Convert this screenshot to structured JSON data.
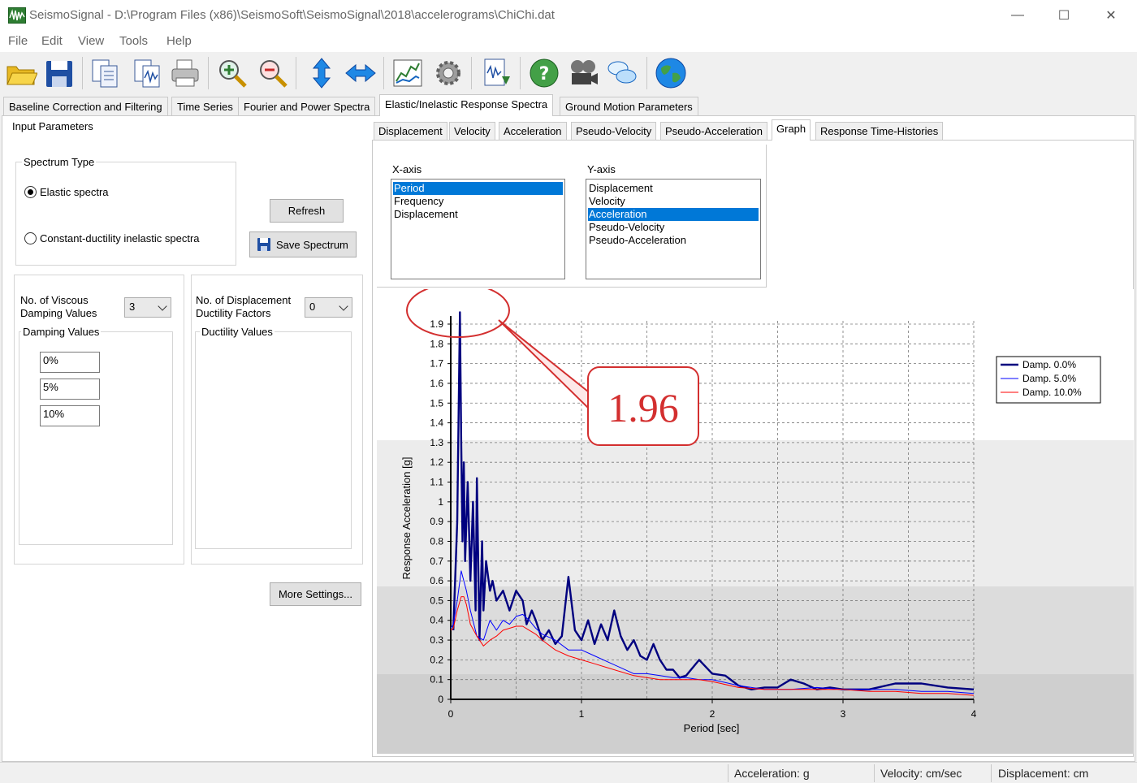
{
  "window": {
    "title": "SeismoSignal - D:\\Program Files (x86)\\SeismoSoft\\SeismoSignal\\2018\\accelerograms\\ChiChi.dat",
    "minimize": "—",
    "maximize": "☐",
    "close": "✕"
  },
  "menu": [
    "File",
    "Edit",
    "View",
    "Tools",
    "Help"
  ],
  "toolbar_icons": [
    "open-folder-icon",
    "save-icon",
    "copy-icon",
    "copy-graph-icon",
    "print-icon",
    "zoom-in-icon",
    "zoom-out-icon",
    "vertical-scale-icon",
    "horizontal-scale-icon",
    "chart-icon",
    "settings-gear-icon",
    "export-icon",
    "help-icon",
    "video-icon",
    "chat-icon",
    "globe-icon"
  ],
  "main_tabs": [
    "Baseline Correction and Filtering",
    "Time Series",
    "Fourier and Power Spectra",
    "Elastic/Inelastic Response Spectra",
    "Ground Motion Parameters"
  ],
  "left": {
    "input_parameters": "Input Parameters",
    "spectrum_type": "Spectrum Type",
    "elastic": "Elastic spectra",
    "inelastic": "Constant-ductility inelastic spectra",
    "refresh": "Refresh",
    "save_spectrum": "Save Spectrum",
    "no_viscous_1": "No. of Viscous",
    "no_viscous_2": "Damping Values",
    "no_viscous_value": "3",
    "damping_values": "Damping Values",
    "damping": [
      "0%",
      "5%",
      "10%"
    ],
    "no_disp_1": "No. of Displacement",
    "no_disp_2": "Ductility Factors",
    "no_disp_value": "0",
    "ductility_values": "Ductility Values",
    "more_settings": "More Settings..."
  },
  "sub_tabs": [
    "Displacement",
    "Velocity",
    "Acceleration",
    "Pseudo-Velocity",
    "Pseudo-Acceleration",
    "Graph",
    "Response Time-Histories"
  ],
  "xaxis_list": {
    "label": "X-axis",
    "items": [
      "Period",
      "Frequency",
      "Displacement"
    ],
    "selected": 0
  },
  "yaxis_list": {
    "label": "Y-axis",
    "items": [
      "Displacement",
      "Velocity",
      "Acceleration",
      "Pseudo-Velocity",
      "Pseudo-Acceleration"
    ],
    "selected": 2
  },
  "annotation": {
    "callout_text": "1.96",
    "color": "#d32f2f"
  },
  "chart_data": {
    "type": "line",
    "xlabel": "Period [sec]",
    "ylabel": "Response Acceleration [g]",
    "xlim": [
      0,
      4
    ],
    "ylim": [
      0,
      1.9
    ],
    "xticks": [
      "0",
      "1",
      "2",
      "3",
      "4"
    ],
    "yticks": [
      "0",
      "0.1",
      "0.2",
      "0.3",
      "0.4",
      "0.5",
      "0.6",
      "0.7",
      "0.8",
      "0.9",
      "1",
      "1.1",
      "1.2",
      "1.3",
      "1.4",
      "1.5",
      "1.6",
      "1.7",
      "1.8",
      "1.9"
    ],
    "grid": true,
    "legend_position": "top-right",
    "series": [
      {
        "name": "Damp. 0.0%",
        "color": "#00007f",
        "x": [
          0.02,
          0.05,
          0.07,
          0.08,
          0.09,
          0.1,
          0.11,
          0.13,
          0.15,
          0.17,
          0.19,
          0.2,
          0.22,
          0.24,
          0.25,
          0.27,
          0.3,
          0.32,
          0.35,
          0.4,
          0.45,
          0.5,
          0.55,
          0.58,
          0.62,
          0.65,
          0.7,
          0.75,
          0.8,
          0.85,
          0.9,
          0.95,
          1.0,
          1.05,
          1.1,
          1.15,
          1.2,
          1.25,
          1.3,
          1.35,
          1.4,
          1.45,
          1.5,
          1.55,
          1.6,
          1.65,
          1.7,
          1.75,
          1.8,
          1.9,
          2.0,
          2.1,
          2.2,
          2.3,
          2.4,
          2.5,
          2.6,
          2.7,
          2.8,
          2.9,
          3.0,
          3.2,
          3.4,
          3.6,
          3.8,
          4.0
        ],
        "y": [
          0.35,
          0.9,
          1.96,
          1.3,
          0.8,
          1.2,
          0.7,
          1.1,
          0.6,
          1.0,
          0.45,
          1.12,
          0.3,
          0.8,
          0.45,
          0.7,
          0.55,
          0.6,
          0.5,
          0.55,
          0.45,
          0.55,
          0.5,
          0.38,
          0.45,
          0.4,
          0.3,
          0.35,
          0.28,
          0.32,
          0.62,
          0.35,
          0.3,
          0.4,
          0.28,
          0.38,
          0.3,
          0.45,
          0.32,
          0.25,
          0.3,
          0.22,
          0.2,
          0.28,
          0.2,
          0.15,
          0.15,
          0.11,
          0.12,
          0.2,
          0.13,
          0.12,
          0.07,
          0.05,
          0.06,
          0.06,
          0.1,
          0.08,
          0.05,
          0.06,
          0.05,
          0.05,
          0.08,
          0.08,
          0.06,
          0.05
        ]
      },
      {
        "name": "Damp. 5.0%",
        "color": "#0000ff",
        "x": [
          0.0,
          0.02,
          0.05,
          0.08,
          0.1,
          0.12,
          0.15,
          0.2,
          0.25,
          0.3,
          0.35,
          0.4,
          0.45,
          0.5,
          0.55,
          0.6,
          0.65,
          0.7,
          0.8,
          0.9,
          1.0,
          1.1,
          1.2,
          1.3,
          1.4,
          1.5,
          1.6,
          1.7,
          1.8,
          1.9,
          2.0,
          2.2,
          2.4,
          2.6,
          2.8,
          3.0,
          3.2,
          3.4,
          3.6,
          3.8,
          4.0
        ],
        "y": [
          0.36,
          0.38,
          0.5,
          0.65,
          0.6,
          0.55,
          0.45,
          0.32,
          0.3,
          0.4,
          0.35,
          0.4,
          0.38,
          0.42,
          0.43,
          0.4,
          0.36,
          0.33,
          0.3,
          0.25,
          0.25,
          0.22,
          0.19,
          0.16,
          0.13,
          0.13,
          0.12,
          0.11,
          0.11,
          0.1,
          0.1,
          0.07,
          0.05,
          0.05,
          0.06,
          0.05,
          0.05,
          0.05,
          0.04,
          0.04,
          0.03
        ]
      },
      {
        "name": "Damp. 10.0%",
        "color": "#ff0000",
        "x": [
          0.0,
          0.02,
          0.05,
          0.08,
          0.1,
          0.12,
          0.15,
          0.2,
          0.25,
          0.3,
          0.35,
          0.4,
          0.45,
          0.5,
          0.55,
          0.6,
          0.65,
          0.7,
          0.8,
          0.9,
          1.0,
          1.1,
          1.2,
          1.3,
          1.4,
          1.5,
          1.6,
          1.7,
          1.8,
          1.9,
          2.0,
          2.2,
          2.4,
          2.6,
          2.8,
          3.0,
          3.2,
          3.4,
          3.6,
          3.8,
          4.0
        ],
        "y": [
          0.35,
          0.36,
          0.45,
          0.52,
          0.52,
          0.48,
          0.38,
          0.32,
          0.27,
          0.3,
          0.32,
          0.35,
          0.36,
          0.37,
          0.37,
          0.35,
          0.33,
          0.3,
          0.25,
          0.22,
          0.2,
          0.18,
          0.16,
          0.14,
          0.12,
          0.11,
          0.1,
          0.1,
          0.1,
          0.1,
          0.09,
          0.06,
          0.05,
          0.05,
          0.05,
          0.05,
          0.04,
          0.04,
          0.03,
          0.03,
          0.02
        ]
      }
    ]
  },
  "status": {
    "acceleration": "Acceleration: g",
    "velocity": "Velocity: cm/sec",
    "displacement": "Displacement: cm"
  }
}
